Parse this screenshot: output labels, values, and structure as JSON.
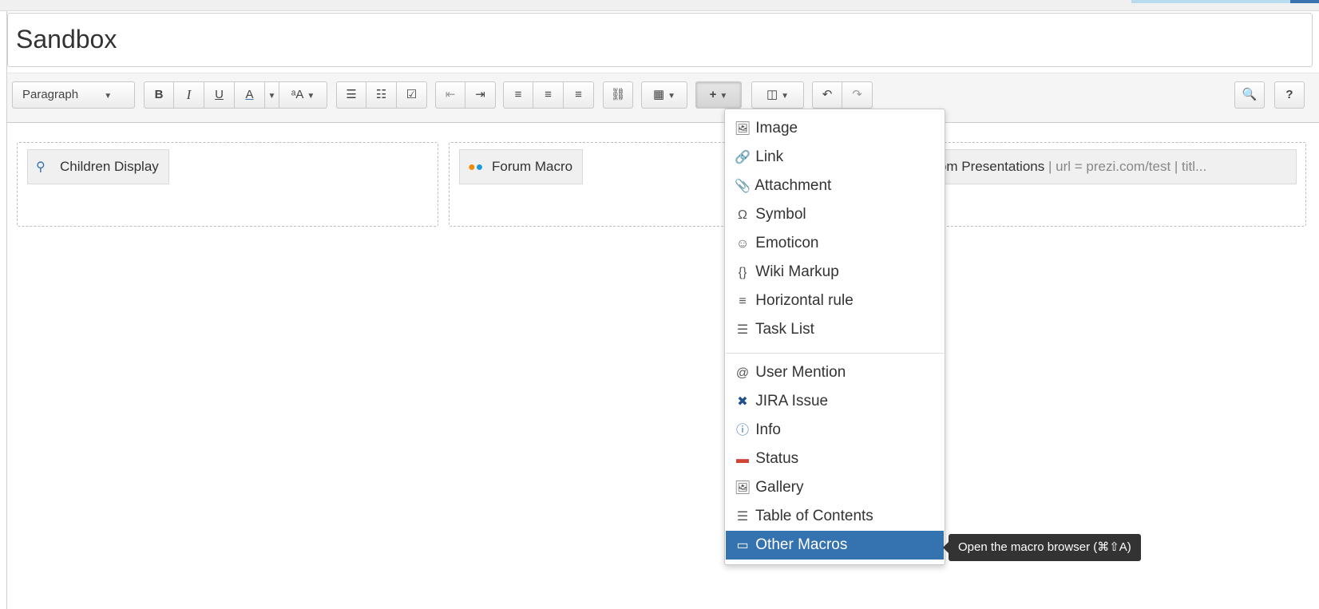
{
  "page": {
    "title": "Sandbox"
  },
  "toolbar": {
    "paragraph_label": "Paragraph",
    "bold": "B",
    "italic": "I",
    "underline": "U",
    "text_color": "A",
    "font_size": "ᵃA",
    "search_label": "🔍",
    "help_label": "?"
  },
  "macros": [
    {
      "label": "Children Display",
      "icon": "children-display-icon"
    },
    {
      "label": "Forum Macro",
      "icon": "forum-macro-icon"
    },
    {
      "label": "ezi.com Presentations",
      "params": " | url = prezi.com/test | titl..."
    }
  ],
  "insert_menu": {
    "items": [
      {
        "label": "Image",
        "icon": "🖼"
      },
      {
        "label": "Link",
        "icon": "🔗"
      },
      {
        "label": "Attachment",
        "icon": "📎"
      },
      {
        "label": "Symbol",
        "icon": "Ω"
      },
      {
        "label": "Emoticon",
        "icon": "☺"
      },
      {
        "label": "Wiki Markup",
        "icon": "{}"
      },
      {
        "label": "Horizontal rule",
        "icon": "≡"
      },
      {
        "label": "Task List",
        "icon": "☰"
      },
      {
        "label": "User Mention",
        "icon": "@"
      },
      {
        "label": "JIRA Issue",
        "icon": "✖"
      },
      {
        "label": "Info",
        "icon": "ⓘ"
      },
      {
        "label": "Status",
        "icon": "▬"
      },
      {
        "label": "Gallery",
        "icon": "🖼"
      },
      {
        "label": "Table of Contents",
        "icon": "☰"
      },
      {
        "label": "Other Macros",
        "icon": "▭"
      }
    ],
    "selected": "Other Macros"
  },
  "tooltip": {
    "text": "Open the macro browser (⌘⇧A)"
  },
  "colors": {
    "selected": "#3572b0",
    "tooltip": "#333333"
  }
}
